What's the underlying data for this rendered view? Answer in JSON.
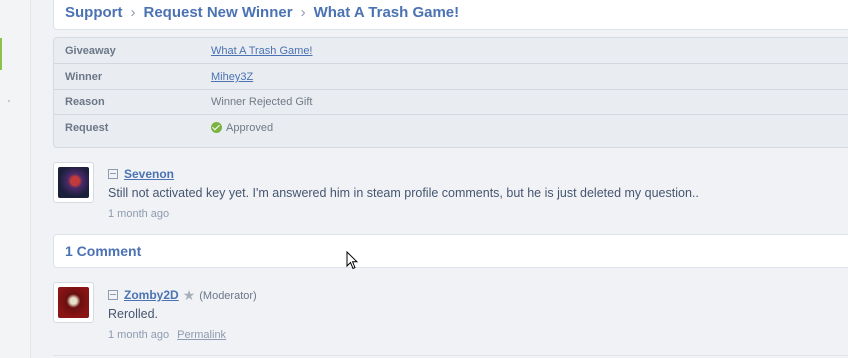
{
  "breadcrumb": {
    "items": [
      "Support",
      "Request New Winner",
      "What A Trash Game!"
    ],
    "separator": "›"
  },
  "details": {
    "rows": [
      {
        "label": "Giveaway",
        "value": "What A Trash Game!"
      },
      {
        "label": "Winner",
        "value": "Mihey3Z"
      },
      {
        "label": "Reason",
        "value": "Winner Rejected Gift"
      },
      {
        "label": "Request",
        "value": "Approved"
      }
    ]
  },
  "request_post": {
    "author": "Sevenon",
    "message": "Still not activated key yet. I'm answered him in steam profile comments, but he is just deleted my question..",
    "time": "1 month ago"
  },
  "comments": {
    "title": "1 Comment",
    "items": [
      {
        "author": "Zomby2D",
        "role": "(Moderator)",
        "message": "Rerolled.",
        "time": "1 month ago",
        "permalink": "Permalink"
      }
    ]
  },
  "colors": {
    "link": "#4b72b3",
    "approved": "#7cb342",
    "accent_bar": "#8bc34a"
  },
  "icons": {
    "approved": "check-circle-icon",
    "collapse": "collapse-minus-icon",
    "moderator": "star-icon",
    "cursor": "mouse-pointer-icon"
  }
}
